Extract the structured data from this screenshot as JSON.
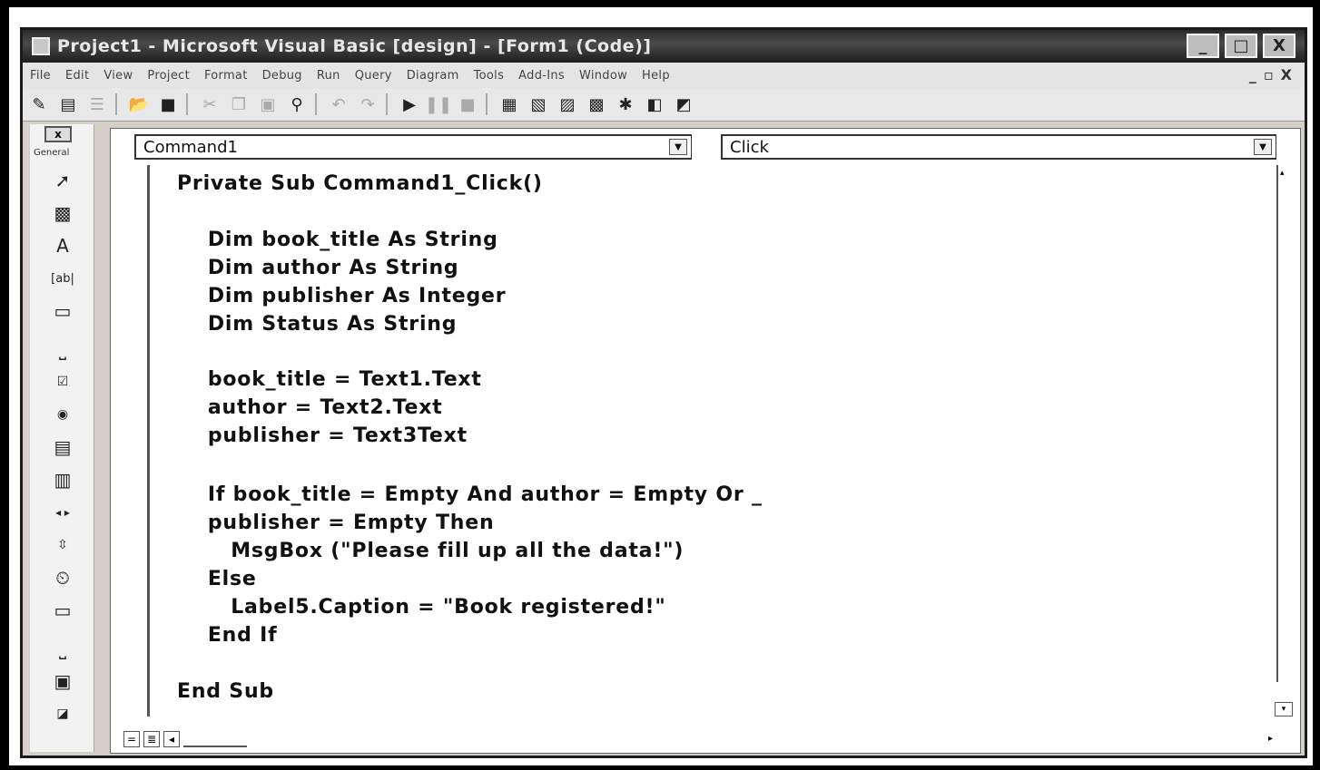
{
  "window": {
    "title": "Project1 - Microsoft Visual Basic [design] - [Form1 (Code)]",
    "controls": {
      "minimize": "_",
      "maximize": "□",
      "close": "X"
    }
  },
  "menu": {
    "items": [
      "File",
      "Edit",
      "View",
      "Project",
      "Format",
      "Debug",
      "Run",
      "Query",
      "Diagram",
      "Tools",
      "Add-Ins",
      "Window",
      "Help"
    ],
    "mdi_controls": {
      "minimize": "_",
      "restore": "▫",
      "close": "X"
    }
  },
  "toolbox": {
    "close": "x",
    "header": "General"
  },
  "code_window": {
    "object_combo": "Command1",
    "procedure_combo": "Click",
    "lines": [
      "Private Sub Command1_Click()",
      "",
      "    Dim book_title As String",
      "    Dim author As String",
      "    Dim publisher As Integer",
      "    Dim Status As String",
      "",
      "    book_title = Text1.Text",
      "    author = Text2.Text",
      "    publisher = Text3Text",
      "",
      "    If book_title = Empty And author = Empty Or _",
      "    publisher = Empty Then",
      "       MsgBox (\"Please fill up all the data!\")",
      "    Else",
      "       Label5.Caption = \"Book registered!\"",
      "    End If",
      "",
      "End Sub"
    ]
  }
}
